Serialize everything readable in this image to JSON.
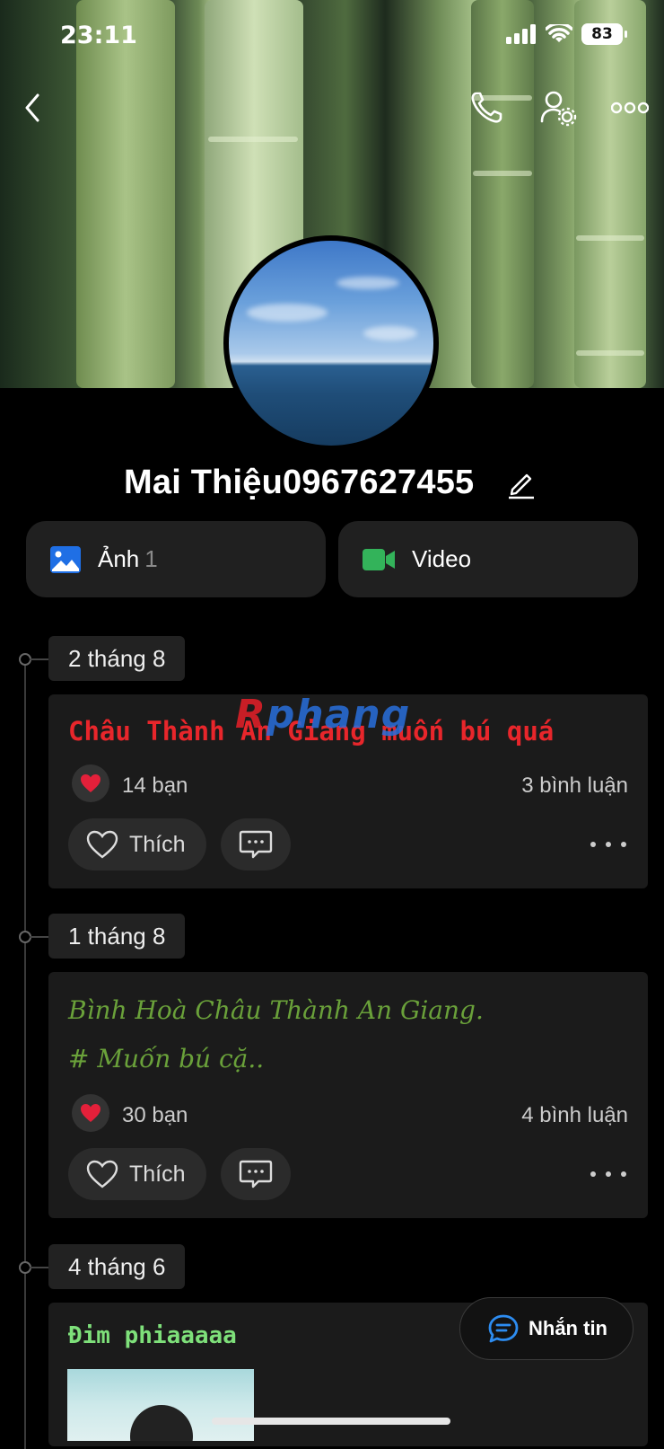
{
  "status_bar": {
    "time": "23:11",
    "battery": "83"
  },
  "profile": {
    "name": "Mai Thiệu0967627455"
  },
  "media": {
    "photos_label": "Ảnh",
    "photos_count": "1",
    "video_label": "Video"
  },
  "watermark": {
    "part1": "R",
    "part2": "phang"
  },
  "posts": [
    {
      "date": "2 tháng 8",
      "text": "Châu Thành An Giang muốn bú quá",
      "text_color": "#e8262b",
      "likes": "14 bạn",
      "comments": "3 bình luận",
      "like_label": "Thích"
    },
    {
      "date": "1 tháng 8",
      "text_line1": "Bình Hoà Châu Thành An Giang.",
      "text_line2": "# Muốn bú cặ..",
      "text_color": "#6aa13a",
      "likes": "30 bạn",
      "comments": "4 bình luận",
      "like_label": "Thích"
    },
    {
      "date": "4 tháng 6",
      "text": "Đim phiaaaaa",
      "text_color": "#7ee07a"
    }
  ],
  "fab": {
    "label": "Nhắn tin"
  },
  "icons": {
    "back": "chevron-left-icon",
    "call": "phone-icon",
    "settings": "user-settings-icon",
    "more": "more-horizontal-icon",
    "edit": "pencil-icon",
    "photo": "image-icon",
    "video": "video-camera-icon",
    "heart": "heart-icon",
    "comment": "comment-icon",
    "message": "chat-bubble-icon"
  }
}
